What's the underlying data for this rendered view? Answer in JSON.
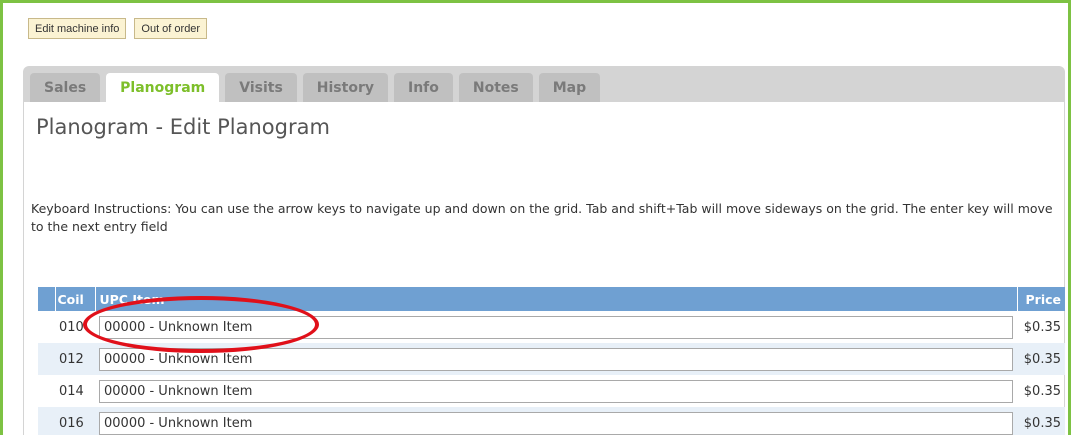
{
  "top_buttons": {
    "edit_machine": "Edit machine info",
    "out_of_order": "Out of order"
  },
  "tabs": [
    {
      "label": "Sales",
      "active": false
    },
    {
      "label": "Planogram",
      "active": true
    },
    {
      "label": "Visits",
      "active": false
    },
    {
      "label": "History",
      "active": false
    },
    {
      "label": "Info",
      "active": false
    },
    {
      "label": "Notes",
      "active": false
    },
    {
      "label": "Map",
      "active": false
    }
  ],
  "page_title": "Planogram - Edit Planogram",
  "instructions": "Keyboard Instructions: You can use the arrow keys to navigate up and down on the grid. Tab and shift+Tab will move sideways on the grid. The enter key will move to the next entry field",
  "grid": {
    "headers": {
      "coil": "Coil",
      "upc": "UPC Item",
      "price": "Price"
    },
    "rows": [
      {
        "coil": "010",
        "upc": "00000 - Unknown Item",
        "price": "$0.35"
      },
      {
        "coil": "012",
        "upc": "00000 - Unknown Item",
        "price": "$0.35"
      },
      {
        "coil": "014",
        "upc": "00000 - Unknown Item",
        "price": "$0.35"
      },
      {
        "coil": "016",
        "upc": "00000 - Unknown Item",
        "price": "$0.35"
      }
    ]
  },
  "colors": {
    "frame_border": "#7dc243",
    "active_tab_text": "#7dbf2a",
    "grid_header": "#6fa0d2",
    "annotation": "#e0101a"
  }
}
